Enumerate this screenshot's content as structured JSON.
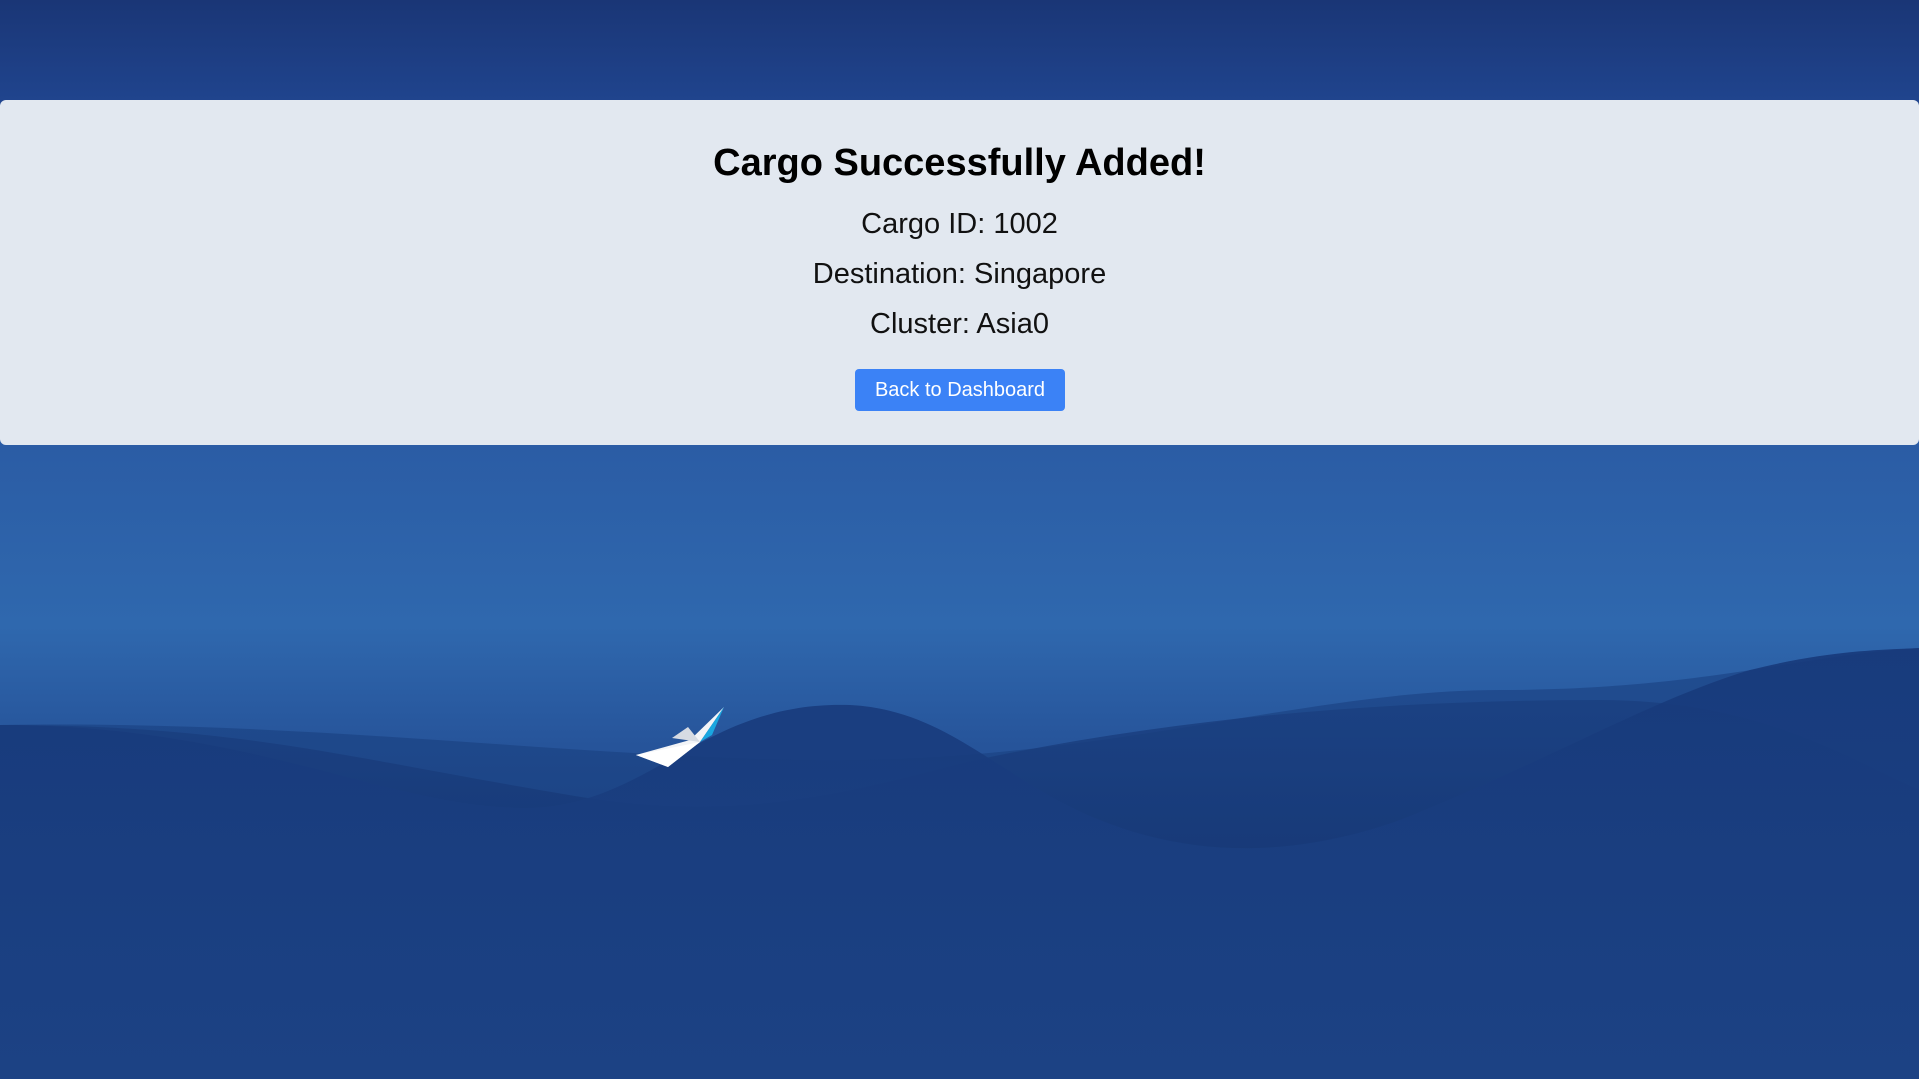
{
  "card": {
    "title": "Cargo Successfully Added!",
    "cargo_id_label": "Cargo ID:",
    "cargo_id": "1002",
    "destination_label": "Destination:",
    "destination": "Singapore",
    "cluster_label": "Cluster:",
    "cluster": "Asia0",
    "back_button": "Back to Dashboard"
  },
  "colors": {
    "card_background": "#e2e8f0",
    "button": "#3b82f6",
    "wallpaper_top": "#1a3676",
    "wallpaper_mid": "#2f68ae"
  },
  "icons": [
    "paper-boat-icon"
  ]
}
